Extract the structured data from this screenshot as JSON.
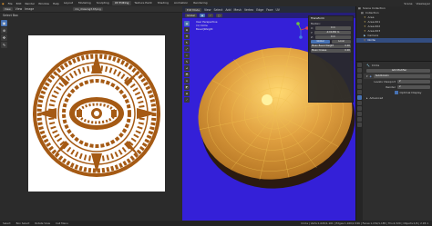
{
  "menubar": {
    "items": [
      "File",
      "Edit",
      "Render",
      "Window",
      "Help"
    ],
    "tabs": [
      "Layout",
      "Modeling",
      "Sculpting",
      "UV Editing",
      "Texture Paint",
      "Shading",
      "Animation",
      "Rendering"
    ],
    "active_tab": "UV Editing",
    "scene": "Scene",
    "view_layer": "ViewLayer"
  },
  "left_editor": {
    "mode": "View",
    "menus": [
      "View",
      "Image"
    ],
    "image_name": "mo_drawing3.tif.png",
    "subheader": "Select Box",
    "colors": {
      "ornament": "#a55a14",
      "canvas": "#ffffff"
    }
  },
  "viewport": {
    "mode": "Edit Mode",
    "menus": [
      "View",
      "Select",
      "Add",
      "Mesh",
      "Vertex",
      "Edge",
      "Face",
      "UV"
    ],
    "transform": "Global",
    "info_lines": [
      "User Perspective",
      "(1) Circle",
      "Bevel|Weight"
    ],
    "colors": {
      "background": "#3420d8",
      "mesh": "#e0a040",
      "wire": "#f0c050"
    },
    "npanel": {
      "title": "Transform",
      "median": "Median:",
      "rows": [
        {
          "label": "X:",
          "value": "0 m"
        },
        {
          "label": "Y:",
          "value": "-0.01456 m"
        },
        {
          "label": "Z:",
          "value": "0 m"
        }
      ],
      "toggles": [
        "Global",
        "Local"
      ],
      "weights": [
        {
          "label": "Mean Bevel Weight",
          "value": "0.00"
        },
        {
          "label": "Mean Crease",
          "value": "0.00"
        }
      ],
      "tabs": [
        "Item",
        "Tool",
        "View"
      ]
    }
  },
  "outliner": {
    "title": "Scene Collection",
    "rows": [
      {
        "name": "Collection",
        "selected": false
      },
      {
        "name": "Area",
        "selected": false
      },
      {
        "name": "Area.001",
        "selected": false
      },
      {
        "name": "Area.002",
        "selected": false
      },
      {
        "name": "Area.003",
        "selected": false
      },
      {
        "name": "Camera",
        "selected": false
      },
      {
        "name": "Circle",
        "selected": true
      }
    ]
  },
  "properties": {
    "object": "Circle",
    "modifier_add": "Add Modifier",
    "modifier_name": "Subdivision",
    "rows": [
      {
        "label": "Levels Viewport",
        "value": "2"
      },
      {
        "label": "Render",
        "value": "2"
      }
    ],
    "optimal_display": "Optimal Display",
    "advanced": "Advanced"
  },
  "statusbar": {
    "items": [
      "Select",
      "Box Select",
      "Rotate View",
      "Call Menu"
    ],
    "stats": "Circle | Verts:1,026/1,161 | Edges:1,160/2,346 | Faces:1,152/1,185 | Tris:2,320 | Objects:1/6 | 2.93.1"
  }
}
